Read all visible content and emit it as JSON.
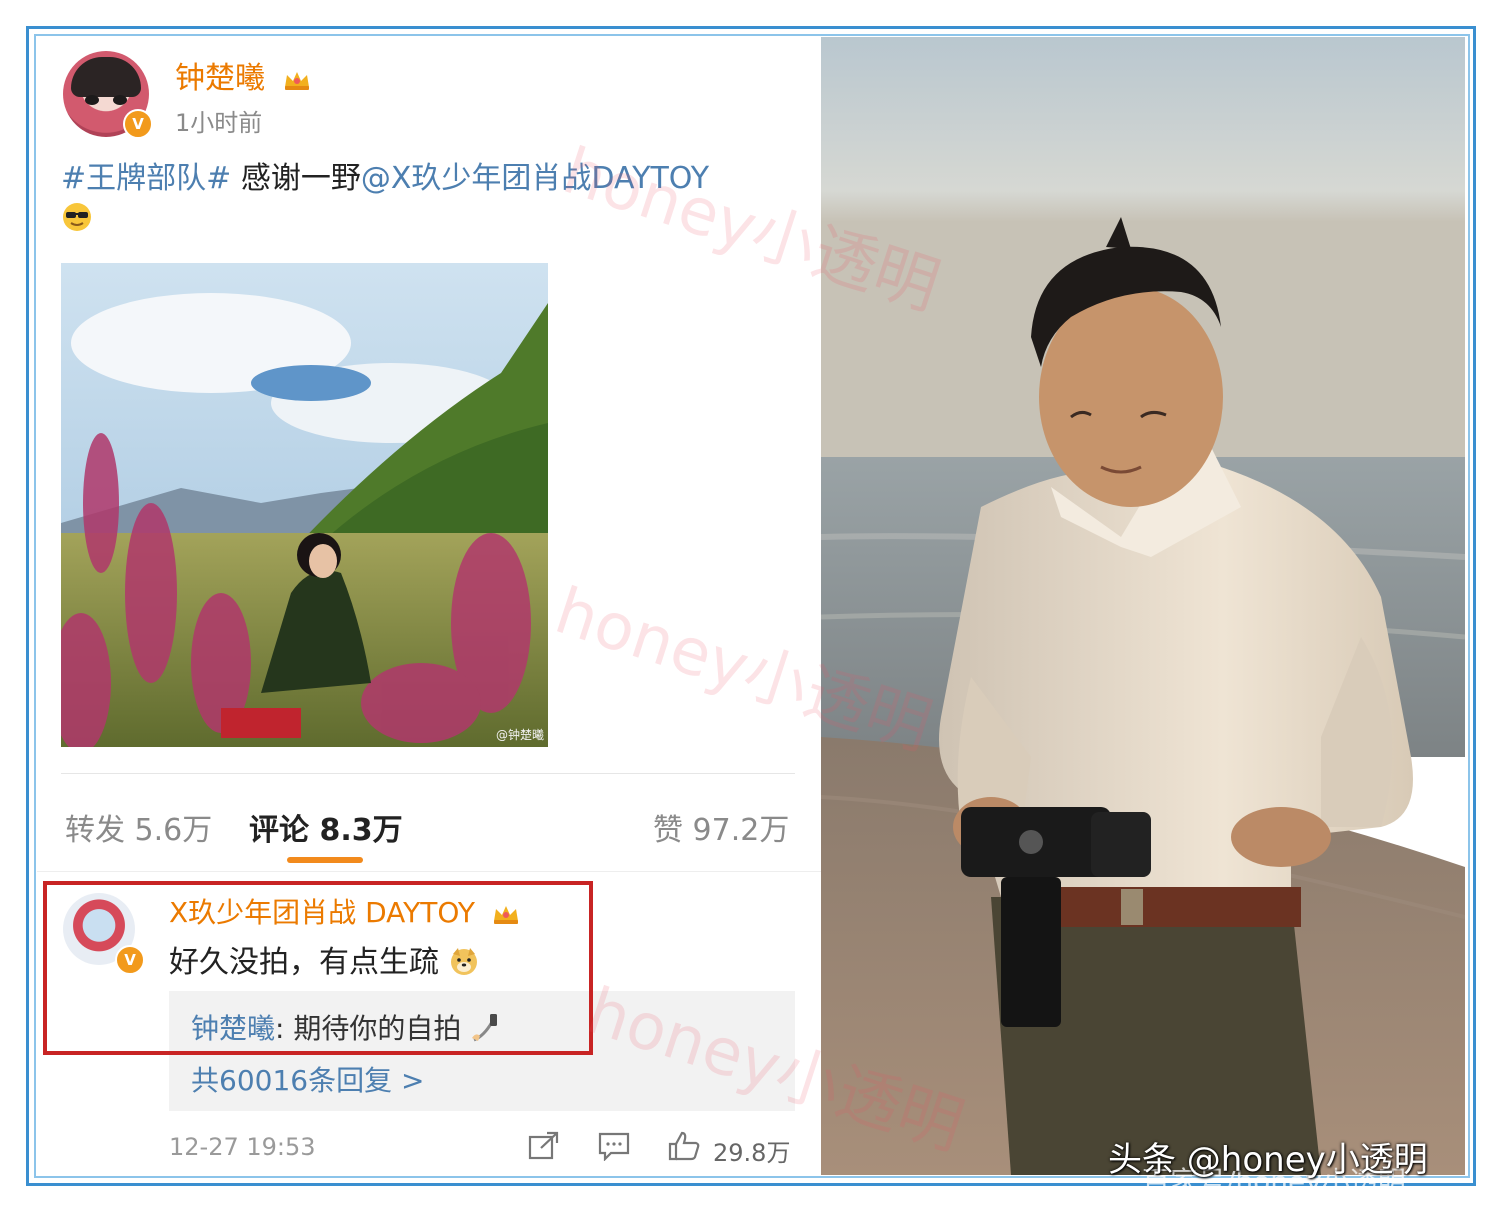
{
  "post": {
    "username": "钟楚曦",
    "verified_badge": "V",
    "time_ago": "1小时前",
    "hashtag": "#王牌部队#",
    "text": " 感谢一野",
    "mention": "@X玖少年团肖战DAYTOY",
    "photo_watermark": "@钟楚曦"
  },
  "stats": {
    "repost": "转发 5.6万",
    "comment": "评论 8.3万",
    "like": "赞 97.2万"
  },
  "comment": {
    "username": "X玖少年团肖战 DAYTOY",
    "verified_badge": "V",
    "text": "好久没拍，有点生疏",
    "reply_name": "钟楚曦",
    "reply_text": ": 期待你的自拍",
    "reply_count": "共60016条回复 >",
    "date": "12-27 19:53",
    "like_count": "29.8万"
  },
  "watermarks": {
    "overlay": "honey小透明",
    "source": "头条 @honey小透明",
    "source_faint": "百家号/honey小透明"
  },
  "colors": {
    "frame_outer": "#3a8fd0",
    "frame_inner": "#8cc4ea",
    "username": "#eb7a00",
    "link": "#4d7fb0",
    "highlight_box": "#c82424",
    "tab_indicator": "#f28a1c"
  },
  "icons": [
    "crown-icon",
    "sunglasses-emoji",
    "doge-emoji",
    "selfie-stick-emoji",
    "share-icon",
    "comment-icon",
    "thumbs-up-icon"
  ]
}
